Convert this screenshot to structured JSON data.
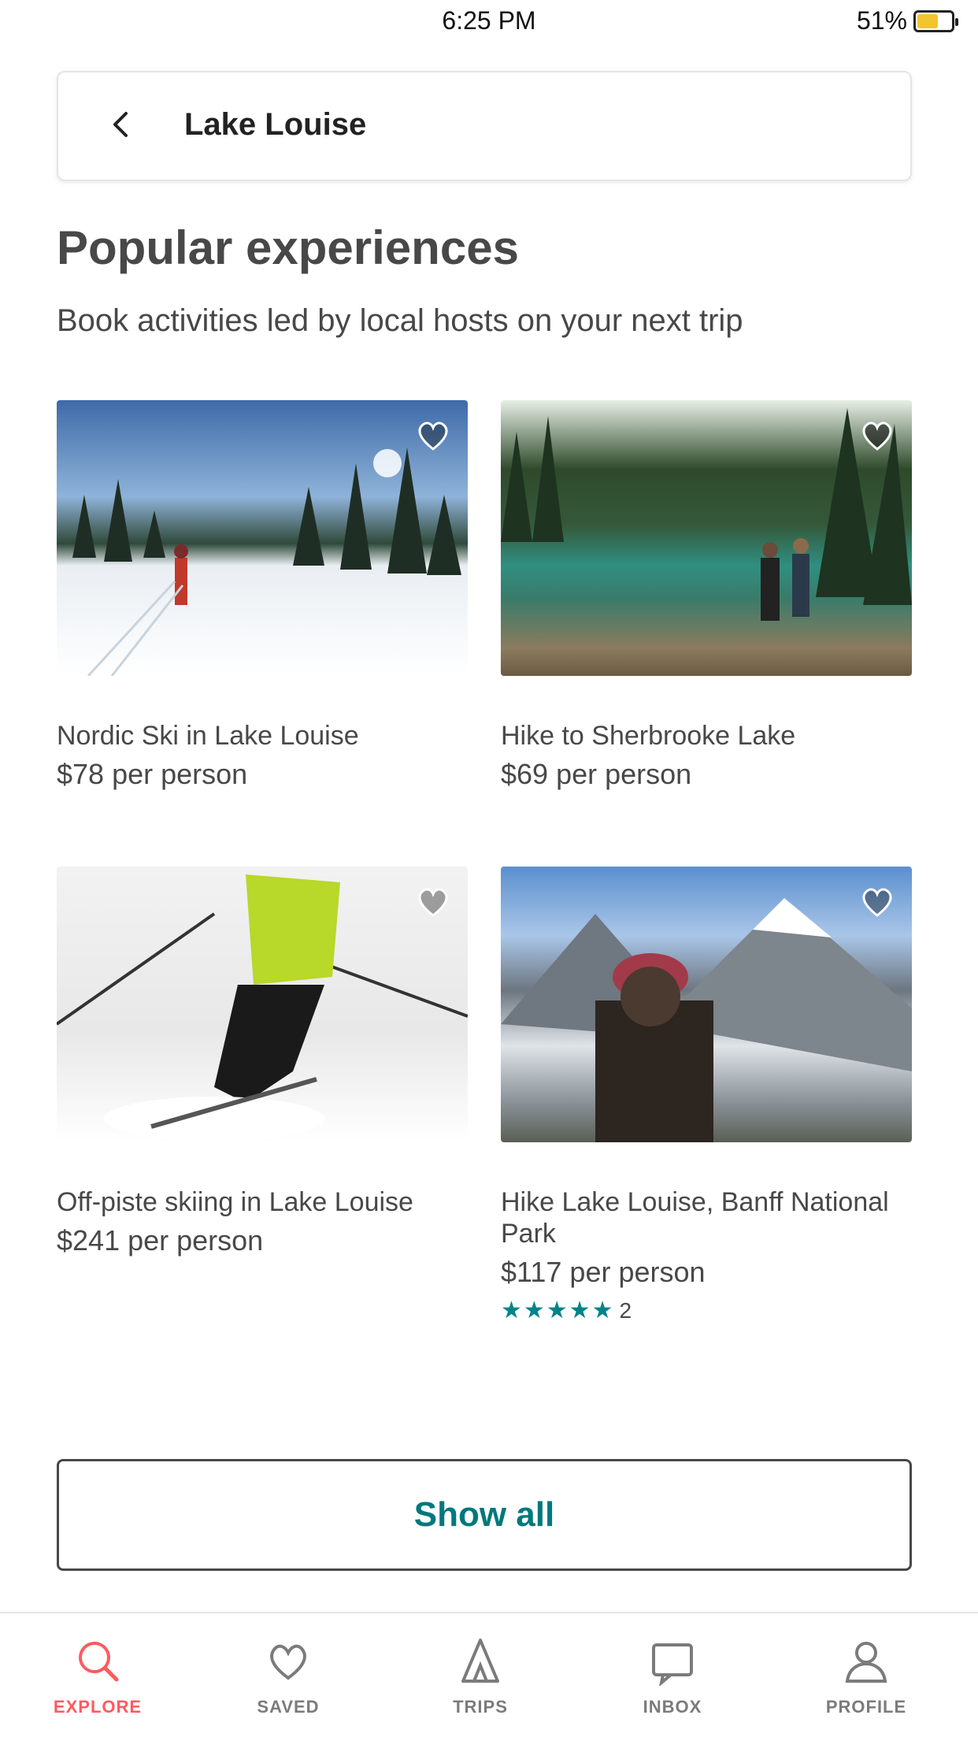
{
  "status_bar": {
    "time": "6:25 PM",
    "battery": "51%"
  },
  "search": {
    "value": "Lake Louise"
  },
  "section": {
    "title": "Popular experiences",
    "subtitle": "Book activities led by local hosts on your next trip"
  },
  "cards": [
    {
      "kicker": "",
      "title": "Nordic Ski in Lake Louise",
      "price": "$78 per person"
    },
    {
      "kicker": "",
      "title": "Hike to Sherbrooke Lake",
      "price": "$69 per person"
    },
    {
      "kicker": "",
      "title": "Off-piste skiing in Lake Louise",
      "price": "$241 per person"
    },
    {
      "kicker": "",
      "title": "Hike Lake Louise, Banff National Park",
      "price": "$117 per person",
      "stars": "★★★★★",
      "reviews": "2"
    }
  ],
  "show_all": "Show all",
  "tabs": [
    {
      "label": "EXPLORE",
      "icon": "search-icon"
    },
    {
      "label": "SAVED",
      "icon": "heart-icon"
    },
    {
      "label": "TRIPS",
      "icon": "trips-icon"
    },
    {
      "label": "INBOX",
      "icon": "inbox-icon"
    },
    {
      "label": "PROFILE",
      "icon": "profile-icon"
    }
  ],
  "colors": {
    "accent": "#ff5a5f",
    "teal": "#00787d",
    "text": "#484848"
  }
}
